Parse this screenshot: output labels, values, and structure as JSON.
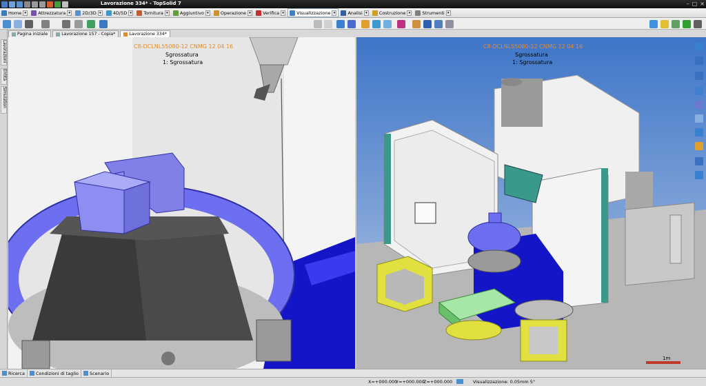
{
  "window": {
    "title": "Lavorazione 334* - TopSolid 7"
  },
  "ribbon": {
    "tabs": [
      {
        "label": "Home",
        "color": "#3a7ac0"
      },
      {
        "label": "Attrezzatura",
        "color": "#7a4fb0"
      },
      {
        "label": "2D/3D",
        "color": "#5a8fd0"
      },
      {
        "label": "4D/5D",
        "color": "#3a9ad0"
      },
      {
        "label": "Tornitura",
        "color": "#c06030"
      },
      {
        "label": "Aggiuntivo",
        "color": "#60a040"
      },
      {
        "label": "Operazione",
        "color": "#d09030"
      },
      {
        "label": "Verifica",
        "color": "#c03030"
      },
      {
        "label": "Visualizzazione",
        "color": "#4080c0"
      },
      {
        "label": "Analisi",
        "color": "#3060a0"
      },
      {
        "label": "Costruzione",
        "color": "#d0a020"
      },
      {
        "label": "Strumenti",
        "color": "#808080"
      }
    ],
    "active": "Visualizzazione"
  },
  "doc_tabs": [
    {
      "label": "Pagina iniziale"
    },
    {
      "label": "Lavorazione 157 - Copia*"
    },
    {
      "label": "Lavorazione 334*"
    }
  ],
  "left_strip": {
    "labels": [
      "Lavorazioni",
      "Entità",
      "Simulation"
    ]
  },
  "viewport_left": {
    "tool": "C8-DCLNL55080-12 CNMG 12 04 16",
    "operation": "Sgrossatura",
    "step": "1: Sgrossatura"
  },
  "viewport_right": {
    "tool": "C8-DCLNL55080-12 CNMG 12 04 16",
    "operation": "Sgrossatura",
    "step": "1: Sgrossatura",
    "scale_label": "1m"
  },
  "bottom_tabs": [
    {
      "label": "Ricerca"
    },
    {
      "label": "Condizioni di taglio"
    },
    {
      "label": "Scenario"
    }
  ],
  "status": {
    "x": "X=+000.000",
    "y": "Y=+000.000",
    "z": "Z=+000.000",
    "display": "Visualizzazione: 0.05mm 5°"
  },
  "colors": {
    "machine_white": "#e8e8e8",
    "fixture_blue": "#6d6ff0",
    "bed_blue": "#1010c0",
    "yellow_stand": "#e0e040",
    "teal": "#3a9a8a"
  }
}
